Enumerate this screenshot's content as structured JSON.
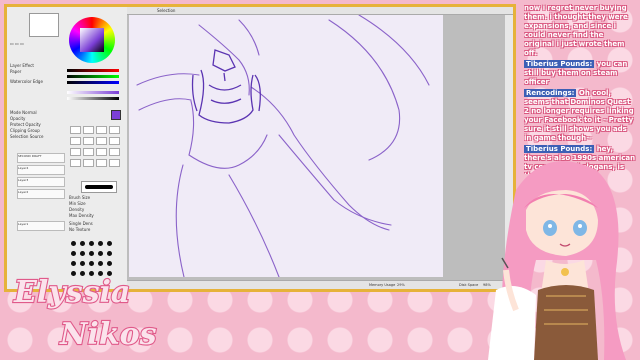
{
  "app": {
    "toolbar_text": "Selection",
    "status_text": "Memory Usage",
    "status_value": "29%",
    "disk_text": "Disk Space",
    "disk_value": "98%"
  },
  "panel": {
    "rows": [
      "Layer Effect",
      "Paper",
      "Watercolor Edge",
      "Mode  Normal",
      "Opacity",
      "Protect Opacity",
      "Clipping Group",
      "Selection Source"
    ],
    "brush_labels": [
      "Brush Size",
      "Min Size",
      "Density",
      "Max Density"
    ],
    "blending": "Single Dens",
    "texture": "No Texture",
    "layers": [
      "SECOND DRAFT",
      "Layer4",
      "Layer3",
      "Layer2",
      "Layer1"
    ]
  },
  "chat": {
    "messages": [
      {
        "name": "",
        "text": "now i regret never buying them. i thought they were expansions, and since i could never find the original i just wrote them off."
      },
      {
        "name": "Tiberius Pounds:",
        "text": "you can still buy them on steam officer"
      },
      {
        "name": "Rencodings:",
        "text": "Oh cool, seems that Dominos Quest 2 no longer requires linking your Facebook to it ~Pretty sure it still shows you ads in game though~"
      },
      {
        "name": "Tiberius Pounds:",
        "text": "hey, there's also 1990s american tv commercial slogans, is that better?"
      }
    ]
  },
  "logo": {
    "line1": "Elyssia",
    "line2": "Nikos"
  },
  "colors": {
    "accent": "#7b3fd6",
    "frame": "#e6b23a",
    "background": "#f4b9cc",
    "logo_fill": "#fbe3ec",
    "logo_stroke": "#e05a8a"
  }
}
